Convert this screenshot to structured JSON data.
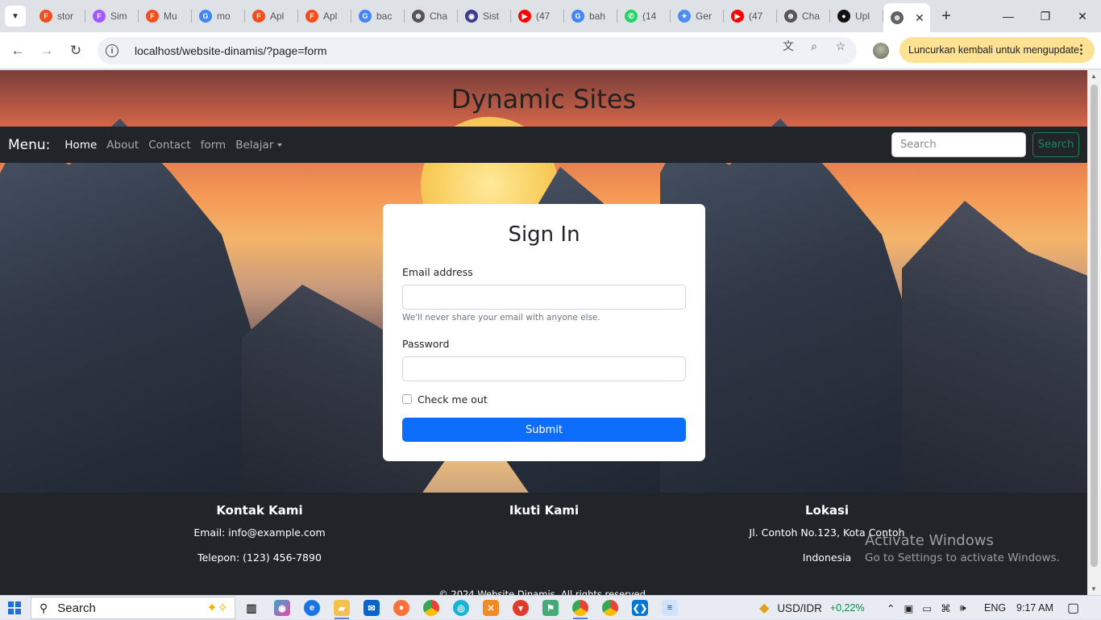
{
  "browser": {
    "tabs": [
      {
        "label": "stor",
        "icon": "figma-icon",
        "color": "#f24e1e"
      },
      {
        "label": "Sim",
        "icon": "figma-icon",
        "color": "#a259ff"
      },
      {
        "label": "Mu",
        "icon": "figma-icon",
        "color": "#f24e1e"
      },
      {
        "label": "mo",
        "icon": "google-icon",
        "color": "#4285f4"
      },
      {
        "label": "Apl",
        "icon": "figma-icon",
        "color": "#f24e1e"
      },
      {
        "label": "Apl",
        "icon": "figma-icon",
        "color": "#f24e1e"
      },
      {
        "label": "bac",
        "icon": "google-icon",
        "color": "#4285f4"
      },
      {
        "label": "Cha",
        "icon": "chatgpt-icon",
        "color": "#555555"
      },
      {
        "label": "Sist",
        "icon": "site-icon",
        "color": "#3b3b8f"
      },
      {
        "label": "(47",
        "icon": "youtube-icon",
        "color": "#ff0000"
      },
      {
        "label": "bah",
        "icon": "google-icon",
        "color": "#4285f4"
      },
      {
        "label": "(14",
        "icon": "whatsapp-icon",
        "color": "#25d366"
      },
      {
        "label": "Ger",
        "icon": "gemini-icon",
        "color": "#4c8df6"
      },
      {
        "label": "(47",
        "icon": "youtube-icon",
        "color": "#ff0000"
      },
      {
        "label": "Cha",
        "icon": "chatgpt-icon",
        "color": "#555555"
      },
      {
        "label": "Upl",
        "icon": "github-icon",
        "color": "#111111"
      }
    ],
    "active_tab_close": "✕",
    "new_tab": "+",
    "url": "localhost/website-dinamis/?page=form",
    "relaunch_label": "Luncurkan kembali untuk mengupdate"
  },
  "page": {
    "site_title": "Dynamic Sites",
    "navbar": {
      "brand": "Menu:",
      "links": [
        "Home",
        "About",
        "Contact",
        "form",
        "Belajar"
      ],
      "search_placeholder": "Search",
      "search_button": "Search"
    },
    "form": {
      "title": "Sign In",
      "email_label": "Email address",
      "email_value": "",
      "email_help": "We'll never share your email with anyone else.",
      "password_label": "Password",
      "password_value": "",
      "checkbox_label": "Check me out",
      "checkbox_checked": false,
      "submit_label": "Submit"
    },
    "footer": {
      "contact": {
        "title": "Kontak Kami",
        "email": "Email: info@example.com",
        "phone": "Telepon: (123) 456-7890"
      },
      "follow": {
        "title": "Ikuti Kami"
      },
      "location": {
        "title": "Lokasi",
        "address": "Jl. Contoh No.123, Kota Contoh",
        "country": "Indonesia"
      },
      "copyright": "© 2024 Website Dinamis. All rights reserved."
    }
  },
  "watermark": {
    "line1": "Activate Windows",
    "line2": "Go to Settings to activate Windows."
  },
  "taskbar": {
    "search_label": "Search",
    "currency_label": "USD/IDR",
    "currency_change": "+0,22%",
    "currency_change_color": "#0a8a4a",
    "language": "ENG",
    "time": "9:17 AM"
  }
}
